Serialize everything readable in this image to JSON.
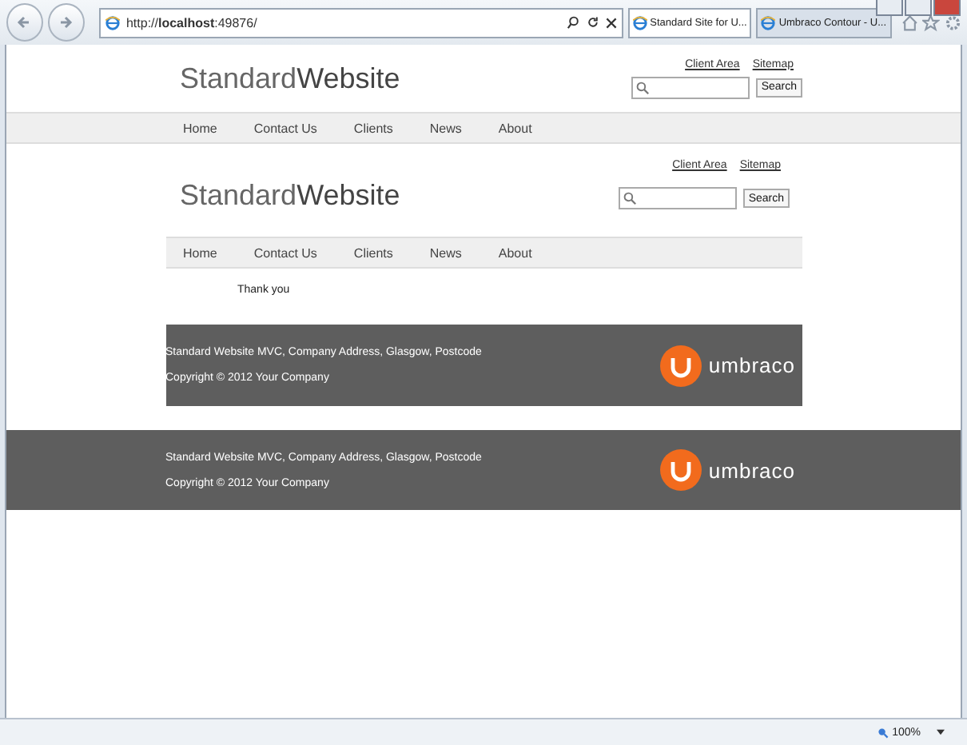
{
  "browser": {
    "address": "http://**localhost**:49876/",
    "tabs": [
      {
        "label": "Standard Site for U...",
        "selected": true
      },
      {
        "label": "Umbraco Contour - U...",
        "selected": false
      }
    ],
    "zoom": "100%"
  },
  "page": {
    "header": {
      "logo_light": "Standard",
      "logo_bold": "Website",
      "links": [
        "Client Area",
        "Sitemap"
      ],
      "search_button": "Search"
    },
    "nav": [
      "Home",
      "Contact Us",
      "Clients",
      "News",
      "About"
    ],
    "nested": {
      "header": {
        "logo_light": "Standard",
        "logo_bold": "Website",
        "links": [
          "Client Area",
          "Sitemap"
        ],
        "search_button": "Search"
      },
      "nav": [
        "Home",
        "Contact Us",
        "Clients",
        "News",
        "About"
      ],
      "message": "Thank you",
      "footer": {
        "address": "Standard Website MVC, Company Address, Glasgow, Postcode",
        "copyright": "Copyright © 2012 Your Company",
        "brand": "umbraco"
      }
    },
    "footer": {
      "address": "Standard Website MVC, Company Address, Glasgow, Postcode",
      "copyright": "Copyright © 2012 Your Company",
      "brand": "umbraco"
    }
  }
}
